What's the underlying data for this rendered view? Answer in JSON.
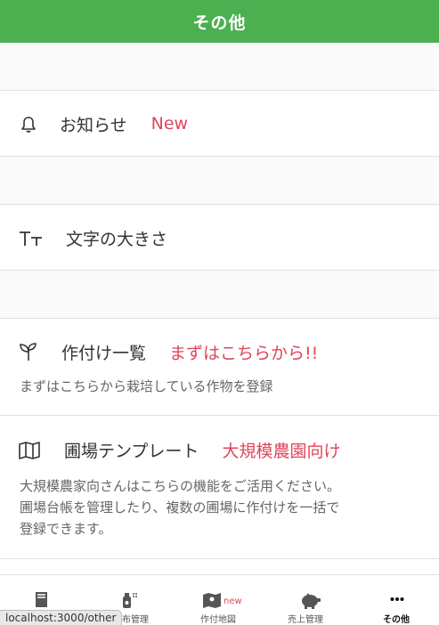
{
  "header": {
    "title": "その他"
  },
  "menu": {
    "notifications": {
      "label": "お知らせ",
      "badge": "New",
      "icon": "bell-icon"
    },
    "font_size": {
      "label": "文字の大きさ",
      "icon": "text-size-icon"
    },
    "crops": {
      "label": "作付け一覧",
      "highlight": "まずはこちらから!!",
      "description": "まずはこちらから栽培している作物を登録",
      "icon": "sprout-icon"
    },
    "field_template": {
      "label": "圃場テンプレート",
      "highlight": "大規模農園向け",
      "description_lines": [
        "大規模農家向さんはこちらの機能をご活用ください。",
        "圃場台帳を管理したり、複数の圃場に作付けを一括で",
        "登録できます。"
      ],
      "icon": "map-icon"
    }
  },
  "nav": {
    "items": [
      {
        "label": "",
        "icon": "book-icon"
      },
      {
        "label": "散布管理",
        "icon": "sprayer-icon"
      },
      {
        "label": "作付地図",
        "badge": "new",
        "icon": "map-pin-icon"
      },
      {
        "label": "売上管理",
        "icon": "piggy-bank-icon"
      },
      {
        "label": "その他",
        "icon": "more-icon",
        "active": true
      }
    ]
  },
  "status_url": "localhost:3000/other",
  "colors": {
    "header": "#4caf50",
    "accent": "#e0455a"
  }
}
